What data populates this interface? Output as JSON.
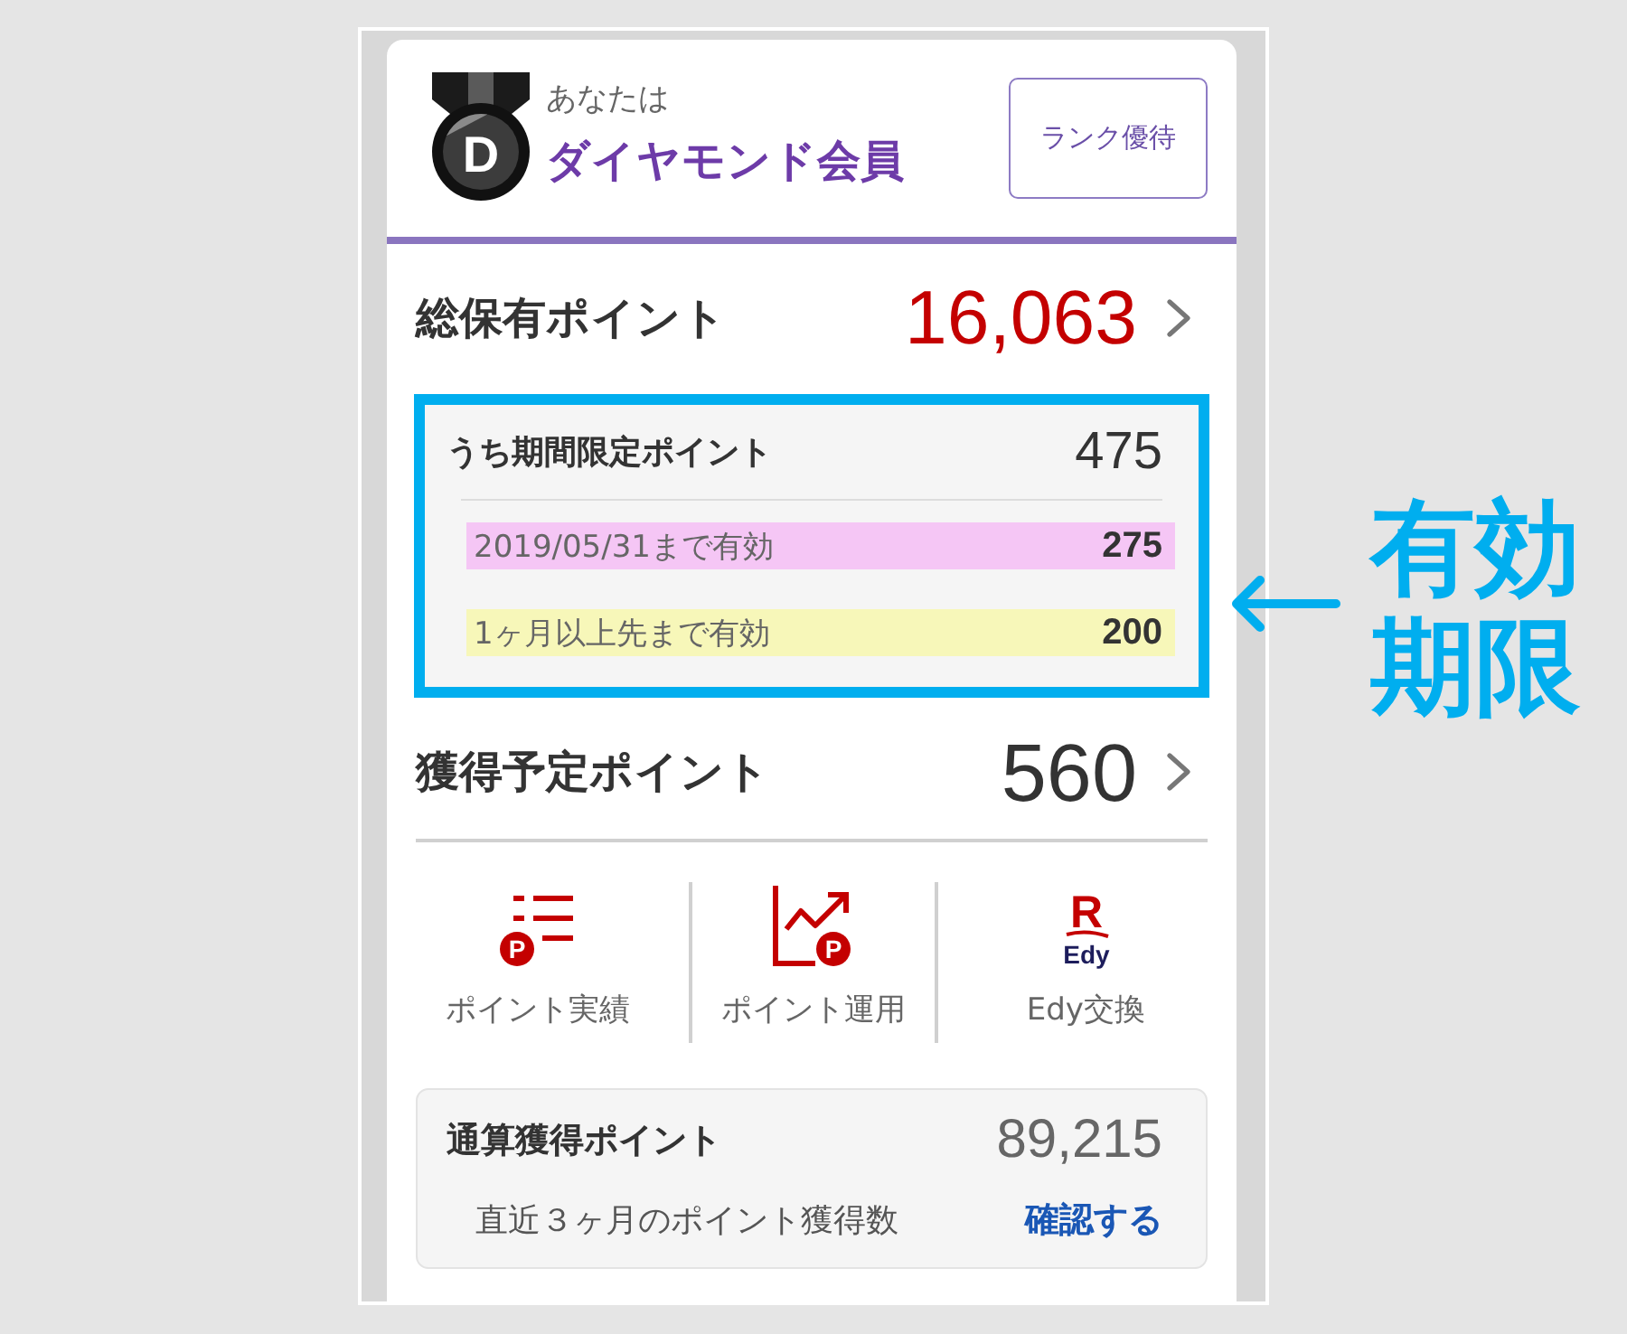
{
  "header": {
    "caption": "あなたは",
    "rank": "ダイヤモンド会員",
    "medal_letter": "D",
    "benefits_button": "ランク優待"
  },
  "total_points": {
    "label": "総保有ポイント",
    "value": "16,063"
  },
  "limited_points": {
    "label": "うち期間限定ポイント",
    "value": "475",
    "items": [
      {
        "label": "2019/05/31まで有効",
        "value": "275",
        "color": "#f5c6f5"
      },
      {
        "label": "1ヶ月以上先まで有効",
        "value": "200",
        "color": "#f7f7b9"
      }
    ]
  },
  "pending_points": {
    "label": "獲得予定ポイント",
    "value": "560"
  },
  "shortcuts": [
    {
      "kind": "history",
      "label": "ポイント実績",
      "badge": "P"
    },
    {
      "kind": "invest",
      "label": "ポイント運用",
      "badge": "P"
    },
    {
      "kind": "edy",
      "label": "Edy交換",
      "logo_mark": "R",
      "logo_name": "Edy"
    }
  ],
  "lifetime_points": {
    "label": "通算獲得ポイント",
    "value": "89,215",
    "note": "直近３ヶ月のポイント獲得数",
    "link": "確認する"
  },
  "annotation": {
    "text": "有効期限"
  }
}
